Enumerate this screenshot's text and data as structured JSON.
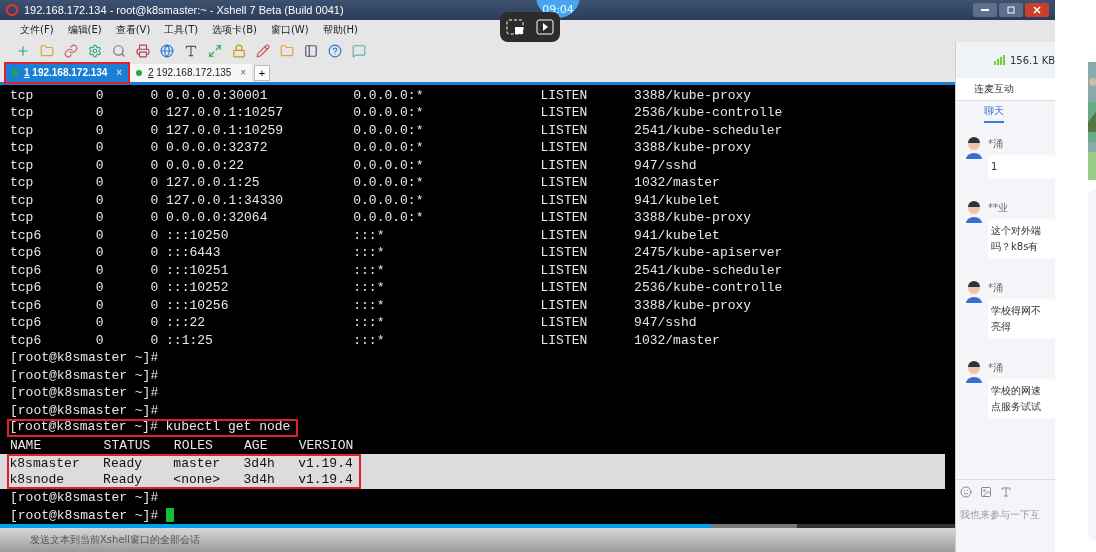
{
  "window": {
    "title": "192.168.172.134 - root@k8smaster:~ - Xshell 7 Beta (Build 0041)"
  },
  "overlay": {
    "clock": "09:04"
  },
  "menu": [
    "文件(F)",
    "编辑(E)",
    "查看(V)",
    "工具(T)",
    "选项卡(B)",
    "窗口(W)",
    "帮助(H)"
  ],
  "tabs": [
    {
      "number": "1",
      "address": "192.168.172.134",
      "close": "×",
      "selected": true,
      "boxed": true
    },
    {
      "number": "2",
      "address": "192.168.172.135",
      "close": "×",
      "selected": false,
      "boxed": false
    }
  ],
  "new_tab": "+",
  "terminal": {
    "lines": [
      {
        "text": "tcp        0      0 0.0.0.0:30001           0.0.0.0:*               LISTEN      3388/kube-proxy",
        "selected": false,
        "boxed": false
      },
      {
        "text": "tcp        0      0 127.0.0.1:10257         0.0.0.0:*               LISTEN      2536/kube-controlle",
        "selected": false,
        "boxed": false
      },
      {
        "text": "tcp        0      0 127.0.0.1:10259         0.0.0.0:*               LISTEN      2541/kube-scheduler",
        "selected": false,
        "boxed": false
      },
      {
        "text": "tcp        0      0 0.0.0.0:32372           0.0.0.0:*               LISTEN      3388/kube-proxy",
        "selected": false,
        "boxed": false
      },
      {
        "text": "tcp        0      0 0.0.0.0:22              0.0.0.0:*               LISTEN      947/sshd",
        "selected": false,
        "boxed": false
      },
      {
        "text": "tcp        0      0 127.0.0.1:25            0.0.0.0:*               LISTEN      1032/master",
        "selected": false,
        "boxed": false
      },
      {
        "text": "tcp        0      0 127.0.0.1:34330         0.0.0.0:*               LISTEN      941/kubelet",
        "selected": false,
        "boxed": false
      },
      {
        "text": "tcp        0      0 0.0.0.0:32064           0.0.0.0:*               LISTEN      3388/kube-proxy",
        "selected": false,
        "boxed": false
      },
      {
        "text": "tcp6       0      0 :::10250                :::*                    LISTEN      941/kubelet",
        "selected": false,
        "boxed": false
      },
      {
        "text": "tcp6       0      0 :::6443                 :::*                    LISTEN      2475/kube-apiserver",
        "selected": false,
        "boxed": false
      },
      {
        "text": "tcp6       0      0 :::10251                :::*                    LISTEN      2541/kube-scheduler",
        "selected": false,
        "boxed": false
      },
      {
        "text": "tcp6       0      0 :::10252                :::*                    LISTEN      2536/kube-controlle",
        "selected": false,
        "boxed": false
      },
      {
        "text": "tcp6       0      0 :::10256                :::*                    LISTEN      3388/kube-proxy",
        "selected": false,
        "boxed": false
      },
      {
        "text": "tcp6       0      0 :::22                   :::*                    LISTEN      947/sshd",
        "selected": false,
        "boxed": false
      },
      {
        "text": "tcp6       0      0 ::1:25                  :::*                    LISTEN      1032/master",
        "selected": false,
        "boxed": false
      },
      {
        "text": "[root@k8smaster ~]#",
        "selected": false,
        "boxed": false
      },
      {
        "text": "[root@k8smaster ~]#",
        "selected": false,
        "boxed": false
      },
      {
        "text": "[root@k8smaster ~]#",
        "selected": false,
        "boxed": false
      },
      {
        "text": "[root@k8smaster ~]#",
        "selected": false,
        "boxed": false
      },
      {
        "text": "[root@k8smaster ~]# kubectl get node",
        "selected": false,
        "boxed": true
      },
      {
        "text": "NAME        STATUS   ROLES    AGE    VERSION",
        "selected": false,
        "boxed": false
      },
      {
        "text": "k8smaster   Ready    master   3d4h   v1.19.4",
        "selected": true,
        "boxed": true
      },
      {
        "text": "k8snode     Ready    <none>   3d4h   v1.19.4",
        "selected": true,
        "boxed": true
      },
      {
        "text": "[root@k8smaster ~]#",
        "selected": false,
        "boxed": false
      },
      {
        "text": "[root@k8smaster ~]#",
        "selected": false,
        "boxed": false,
        "cursor": true
      }
    ]
  },
  "status_bar": "发送文本到当前Xshell窗口的全部会话",
  "player": {
    "level": 0.745
  },
  "chat": {
    "speed": "156.1 KB",
    "section": "连麦互动",
    "tabs": [
      {
        "label": "聊天",
        "selected": true
      }
    ],
    "messages": [
      {
        "name": "*涌",
        "lines": [
          "1"
        ]
      },
      {
        "name": "**业",
        "lines": [
          "这个对外端",
          "吗？k8s有"
        ]
      },
      {
        "name": "*涌",
        "lines": [
          "学校得网不",
          "亮得"
        ]
      },
      {
        "name": "*涌",
        "lines": [
          "学校的网速",
          "点服务试试"
        ]
      }
    ],
    "placeholder": "我也来参与一下互"
  }
}
